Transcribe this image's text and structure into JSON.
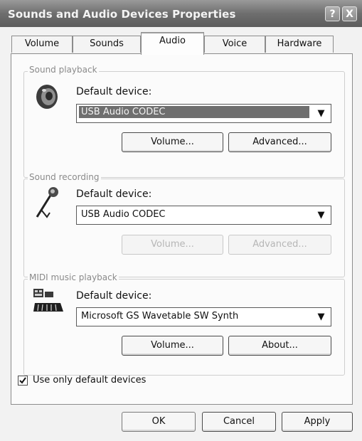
{
  "window": {
    "title": "Sounds and Audio Devices Properties",
    "help_glyph": "?",
    "close_glyph": "X"
  },
  "tabs": [
    "Volume",
    "Sounds",
    "Audio",
    "Voice",
    "Hardware"
  ],
  "active_tab": "Audio",
  "playback": {
    "group_label": "Sound playback",
    "default_device_label": "Default device:",
    "device_value": "USB Audio CODEC",
    "volume_button": "Volume...",
    "advanced_button": "Advanced..."
  },
  "recording": {
    "group_label": "Sound recording",
    "default_device_label": "Default device:",
    "device_value": "USB Audio CODEC",
    "volume_button": "Volume...",
    "advanced_button": "Advanced..."
  },
  "midi": {
    "group_label": "MIDI music playback",
    "default_device_label": "Default device:",
    "device_value": "Microsoft GS Wavetable SW Synth",
    "volume_button": "Volume...",
    "about_button": "About..."
  },
  "checkbox": {
    "label": "Use only default devices",
    "checked": true
  },
  "footer": {
    "ok": "OK",
    "cancel": "Cancel",
    "apply": "Apply"
  },
  "icons": {
    "playback": "speaker-icon",
    "recording": "microphone-icon",
    "midi": "midi-keyboard-icon",
    "dropdown": "chevron-down-icon",
    "checkbox": "checkmark-icon"
  }
}
